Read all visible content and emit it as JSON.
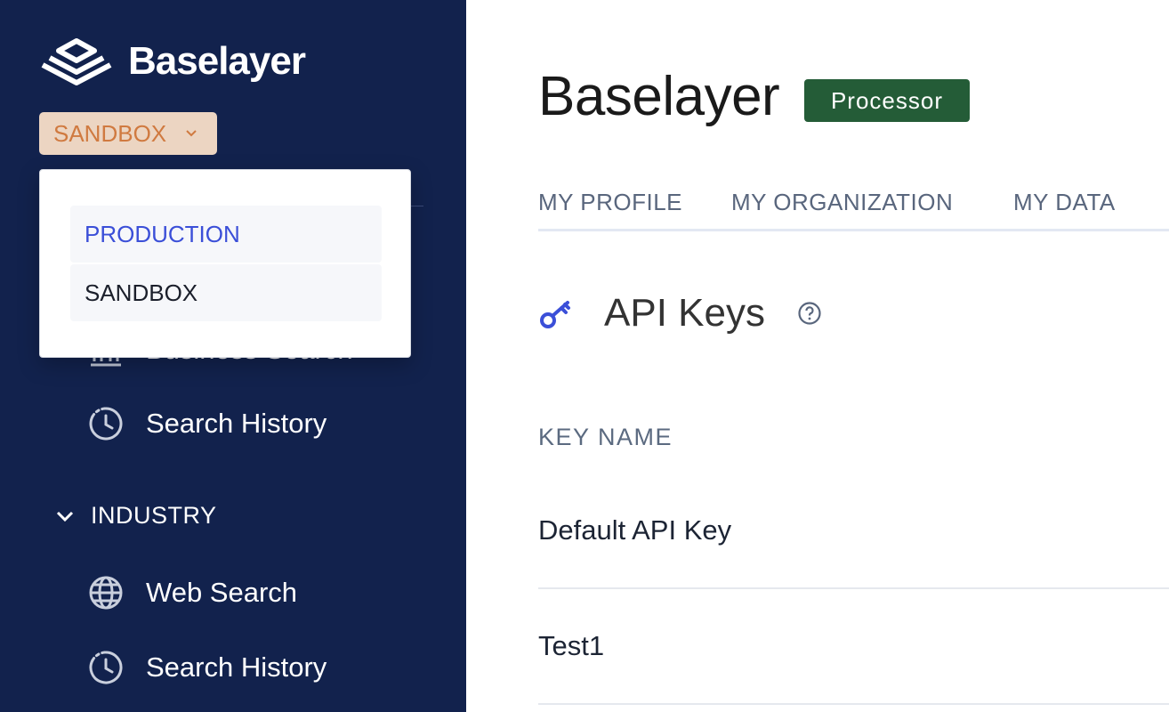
{
  "sidebar": {
    "brand": "Baselayer",
    "environment": {
      "selected": "SANDBOX",
      "options": [
        "PRODUCTION",
        "SANDBOX"
      ]
    },
    "items": [
      {
        "label": "Business Search",
        "icon": "building-icon"
      },
      {
        "label": "Search History",
        "icon": "clock-icon"
      }
    ],
    "sections": [
      {
        "label": "INDUSTRY",
        "items": [
          {
            "label": "Web Search",
            "icon": "globe-icon"
          },
          {
            "label": "Search History",
            "icon": "clock-icon"
          }
        ]
      }
    ]
  },
  "main": {
    "title": "Baselayer",
    "badge": "Processor",
    "tabs": [
      "MY PROFILE",
      "MY ORGANIZATION",
      "MY DATA"
    ],
    "section_title": "API Keys",
    "table": {
      "column": "KEY NAME",
      "rows": [
        "Default API Key",
        "Test1"
      ]
    }
  },
  "colors": {
    "sidebar_bg": "#12224d",
    "badge_bg": "#245c37",
    "env_bg": "#ecd5c2",
    "env_text": "#d07a40",
    "accent_blue": "#3b4fd8"
  }
}
